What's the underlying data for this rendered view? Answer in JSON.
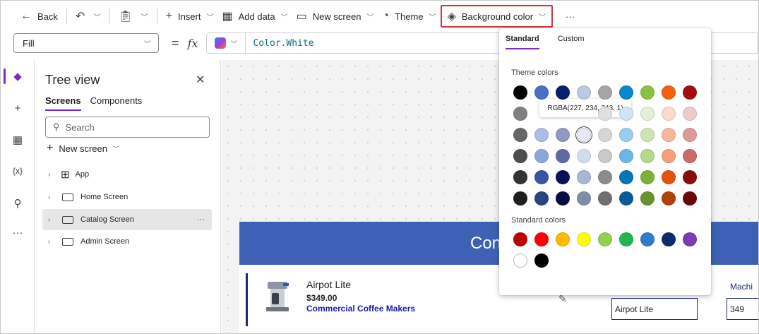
{
  "toolbar": {
    "back": "Back",
    "insert": "Insert",
    "add_data": "Add data",
    "new_screen": "New screen",
    "theme": "Theme",
    "background_color": "Background color",
    "more": "···"
  },
  "formula_bar": {
    "property": "Fill",
    "equals": "=",
    "fx": "fx",
    "formula": "Color.White"
  },
  "tree_view": {
    "title": "Tree view",
    "tabs": [
      "Screens",
      "Components"
    ],
    "search_placeholder": "Search",
    "new_screen": "New screen",
    "items": [
      {
        "label": "App"
      },
      {
        "label": "Home Screen"
      },
      {
        "label": "Catalog Screen",
        "selected": true
      },
      {
        "label": "Admin Screen"
      }
    ],
    "more": "···"
  },
  "canvas": {
    "banner_text": "Con",
    "item": {
      "name": "Airpot Lite",
      "price": "$349.00",
      "category": "Commercial Coffee Makers"
    },
    "field_label": "Machi",
    "field1_value": "Airpot Lite",
    "field2_value": "349"
  },
  "color_picker": {
    "tabs": [
      "Standard",
      "Custom"
    ],
    "theme_colors_title": "Theme colors",
    "standard_colors_title": "Standard colors",
    "tooltip": "RGBA(227, 234, 243, 1)",
    "theme_colors": [
      [
        "#000000",
        "#4a6fc4",
        "#0a1e6e",
        "#b9c9e3",
        "#a6a6a6",
        "#0a86d1",
        "#8cc140",
        "#f2620e",
        "#a50d0d"
      ],
      [
        "#808080",
        "#c6d2ee",
        "#c7c7d6",
        "#d9e1ef",
        "#e0e0e0",
        "#cfe4f4",
        "#e3f0d3",
        "#fbdccc",
        "#eecaca"
      ],
      [
        "#666666",
        "#aabde6",
        "#9199c2",
        "#e3eaf3",
        "#d6d6d6",
        "#98cdee",
        "#cde5b0",
        "#f8b799",
        "#de9999"
      ],
      [
        "#4d4d4d",
        "#8aa6dc",
        "#5e69a3",
        "#d0dcee",
        "#c9c9c9",
        "#6cb7e8",
        "#b3d98b",
        "#f6a07a",
        "#cf6a6a"
      ],
      [
        "#333333",
        "#3656a6",
        "#0a1257",
        "#a7b8d4",
        "#8c8c8c",
        "#0874b8",
        "#7db036",
        "#e2530c",
        "#8c0b0b"
      ],
      [
        "#1f1f1f",
        "#2a4482",
        "#070e44",
        "#7f8ea8",
        "#707070",
        "#065d93",
        "#67922c",
        "#b2410a",
        "#6a0808"
      ]
    ],
    "standard_colors": [
      "#c00000",
      "#ff0000",
      "#ffb900",
      "#ffff00",
      "#92d050",
      "#21b550",
      "#2f7bd1",
      "#102a6e",
      "#7c3bb2",
      "#ffffff",
      "#000000"
    ]
  }
}
